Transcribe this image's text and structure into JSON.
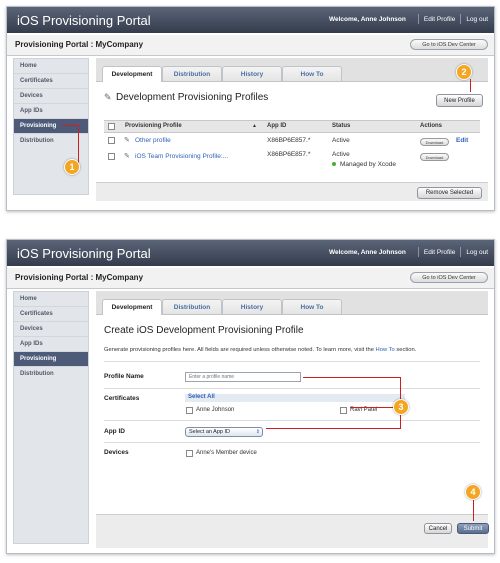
{
  "colors": {
    "titlebar": "#3b4354",
    "sidebar_active": "#4d5b79",
    "callout": "#f4a521",
    "callout_line": "#cc2020",
    "link": "#2f63b6",
    "status_green": "#4caa3c"
  },
  "header": {
    "title": "iOS Provisioning Portal",
    "welcome": "Welcome, Anne Johnson",
    "edit_profile": "Edit Profile",
    "log_out": "Log out",
    "company": "Provisioning Portal : MyCompany",
    "dev_center": "Go to iOS Dev Center"
  },
  "sidebar": {
    "items": [
      {
        "label": "Home"
      },
      {
        "label": "Certificates"
      },
      {
        "label": "Devices"
      },
      {
        "label": "App IDs"
      },
      {
        "label": "Provisioning"
      },
      {
        "label": "Distribution"
      }
    ]
  },
  "tabs": [
    {
      "label": "Development"
    },
    {
      "label": "Distribution"
    },
    {
      "label": "History"
    },
    {
      "label": "How To"
    }
  ],
  "panel1": {
    "heading": "Development Provisioning Profiles",
    "new_profile": "New Profile",
    "columns": {
      "profile": "Provisioning Profile",
      "app_id": "App ID",
      "status": "Status",
      "actions": "Actions"
    },
    "rows": [
      {
        "name": "Other profile",
        "app_id": "X86BP6E857.*",
        "status": "Active",
        "download": "Download",
        "edit": "Edit"
      },
      {
        "name": "iOS Team Provisioning Profile:...",
        "app_id": "X86BP6E857.*",
        "status": "Active",
        "managed": "Managed by Xcode",
        "download": "Download"
      }
    ],
    "remove_selected": "Remove Selected",
    "callouts": [
      "1",
      "2"
    ]
  },
  "panel2": {
    "heading": "Create iOS Development Provisioning Profile",
    "intro_prefix": "Generate provisioning profiles here. All fields are required unless otherwise noted. To learn more, visit the ",
    "intro_link": "How To",
    "intro_suffix": " section.",
    "profile_name_label": "Profile Name",
    "profile_name_placeholder": "Enter a profile name",
    "certificates_label": "Certificates",
    "select_all": "Select All",
    "certificates": [
      "Anne Johnson",
      "Ravi Patel"
    ],
    "app_id_label": "App ID",
    "app_id_value": "Select an App ID",
    "devices_label": "Devices",
    "devices": [
      "Anne's Member device"
    ],
    "cancel": "Cancel",
    "submit": "Submit",
    "callouts": [
      "3",
      "4"
    ]
  }
}
